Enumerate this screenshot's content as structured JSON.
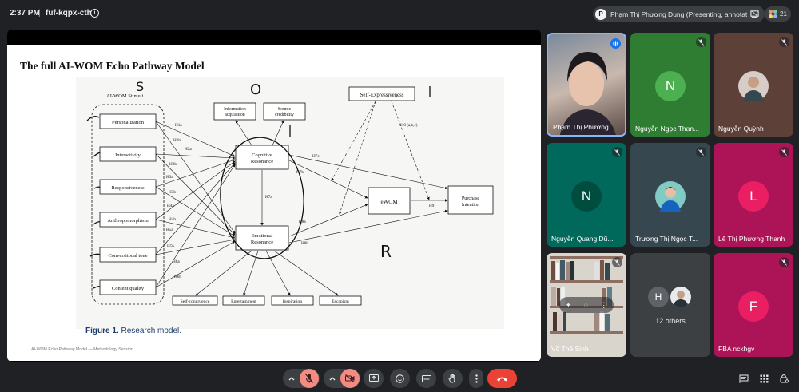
{
  "meeting": {
    "time": "2:37 PM",
    "separator": "|",
    "code": "fuf-kqpx-cth"
  },
  "presenter_chip": {
    "initial": "P",
    "label": "Phạm Thị Phương Dung (Presenting, annotating)"
  },
  "people_count": "21",
  "colors": {
    "background": "#202124",
    "tile_green": "#2e7d32",
    "tile_teal": "#00695c",
    "tile_pink": "#ad1457",
    "mute_red": "#f28b82",
    "hangup": "#ea4335",
    "accent_blue": "#8ab4f8"
  },
  "slide": {
    "title": "The full AI-WOM Echo Pathway Model",
    "footer": "AI-WOM Echo Pathway Model — Methodology Session",
    "caption_label": "Figure 1.",
    "caption_text": "Research model.",
    "diagram": {
      "stimuli_group": "AI-WOM Stimuli",
      "stimuli": [
        "Personalization",
        "Interactivity",
        "Responsiveness",
        "Anthropomorphism",
        "Conversitoual tone",
        "Content quality"
      ],
      "top_boxes": [
        "Information acquisition",
        "Source credibility"
      ],
      "self_expressiveness": "Self-Expressiveness",
      "cognitive": "Cognitive Resonance",
      "emotional": "Emotional Resonance",
      "ewom": "eWOM",
      "purchase": "Purchase Intention",
      "bottom_boxes": [
        "Self-congruence",
        "Entertainment",
        "Inspiration",
        "Escapism"
      ],
      "paths": [
        "H1a",
        "H1b",
        "H2a",
        "H2b",
        "H3a",
        "H3b",
        "H4a",
        "H4b",
        "H5a",
        "H5b",
        "H6a",
        "H6b",
        "H7a",
        "H7b",
        "H7c",
        "H8a",
        "H8b",
        "H9",
        "H10 (a,b,c)"
      ],
      "annotations": [
        "S",
        "O",
        "R",
        "|",
        "|"
      ]
    }
  },
  "participants": [
    {
      "name": "Phạm Thị Phương ...",
      "initial": "",
      "kind": "video",
      "speaking": true
    },
    {
      "name": "Nguyễn Ngọc Than...",
      "initial": "N",
      "kind": "initial",
      "muted": true
    },
    {
      "name": "Nguyễn Quỳnh",
      "initial": "",
      "kind": "photo",
      "muted": true
    },
    {
      "name": "Nguyễn Quang Dũ...",
      "initial": "N",
      "kind": "initial",
      "muted": true
    },
    {
      "name": "Trương Thị Ngọc T...",
      "initial": "",
      "kind": "photo",
      "muted": true
    },
    {
      "name": "Lê Thị Phương Thanh",
      "initial": "L",
      "kind": "initial",
      "muted": true
    },
    {
      "name": "Võ Thế Sinh",
      "initial": "",
      "kind": "video",
      "muted": true
    },
    {
      "name": "12 others",
      "initial": "H",
      "kind": "group"
    },
    {
      "name": "FBA nckhgv",
      "initial": "F",
      "kind": "initial",
      "muted": true
    }
  ],
  "icons": {
    "info": "info-icon",
    "present": "present-to-all-icon",
    "people": "people-icon",
    "mic": "mic-off-icon",
    "cam": "videocam-off-icon",
    "share": "present-icon",
    "emoji": "emoji-icon",
    "cc": "captions-icon",
    "hand": "hand-icon",
    "more": "more-vert-icon",
    "hangup": "call-end-icon",
    "chat": "chat-icon",
    "activities": "apps-icon",
    "lock": "lock-person-icon"
  }
}
